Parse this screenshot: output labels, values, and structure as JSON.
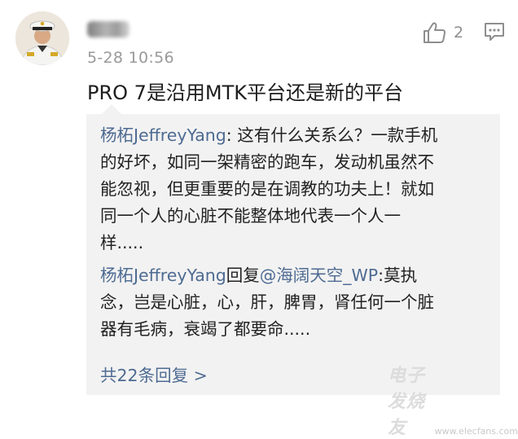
{
  "post": {
    "timestamp": "5-28 10:56",
    "like_count": "2",
    "text": "PRO 7是沿用MTK平台还是新的平台"
  },
  "replies": [
    {
      "author": "杨柘JeffreyYang",
      "separator": ": ",
      "lines": [
        "这有什么关系么？一款手机",
        "的好坏，如同一架精密的跑车，发动机虽然不",
        "能忽视，但更重要的是在调教的功夫上！就如",
        "同一个人的心脏不能整体地代表一个人一",
        "样....."
      ]
    },
    {
      "author": "杨柘JeffreyYang",
      "reply_word": "回复",
      "mention": "@海阔天空_WP",
      "separator": ":",
      "lines": [
        "莫执",
        "念，岂是心脏，心，肝，脾胃，肾任何一个脏",
        "器有毛病，衰竭了都要命....."
      ]
    }
  ],
  "more_replies": "共22条回复 >",
  "watermark": {
    "text": "电子发烧友",
    "url": "www.elecfans.com"
  },
  "icons": {
    "like": "thumbs-up-icon",
    "comment": "comment-icon"
  },
  "colors": {
    "link": "#4e6b92",
    "reply_background": "#f2f2f2",
    "timestamp": "#9a9a9a"
  }
}
